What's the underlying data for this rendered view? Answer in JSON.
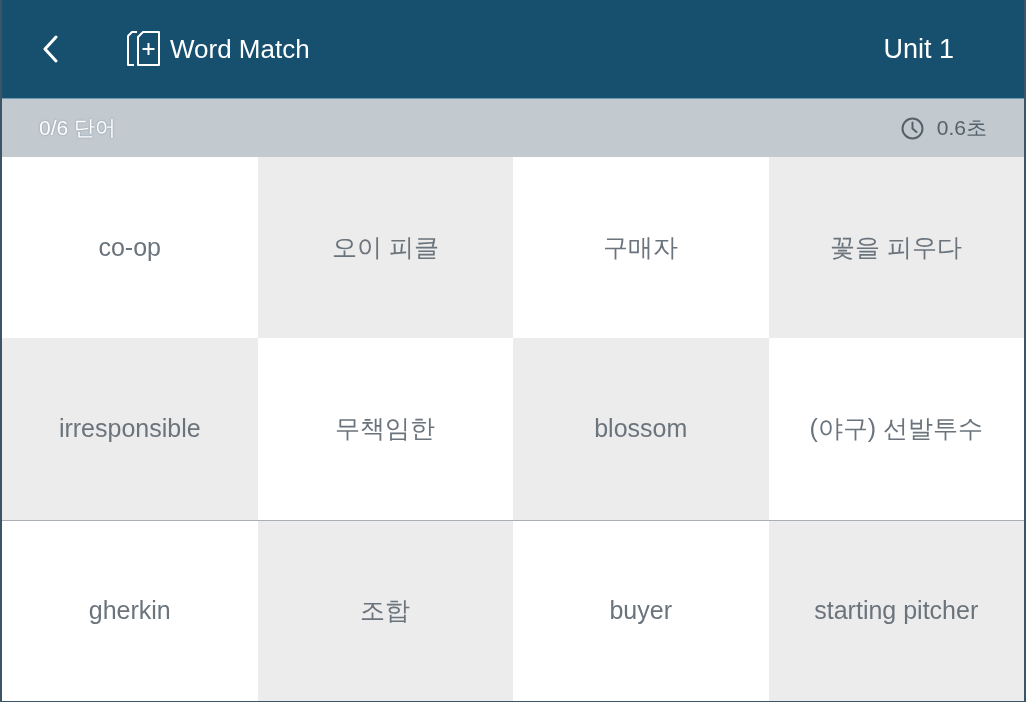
{
  "header": {
    "title": "Word Match",
    "unit": "Unit 1"
  },
  "status_bar": {
    "count": "0/6 단어",
    "time": "0.6초"
  },
  "board": {
    "rows": [
      [
        {
          "text": "co-op"
        },
        {
          "text": "오이 피클"
        },
        {
          "text": "구매자"
        },
        {
          "text": "꽃을 피우다"
        }
      ],
      [
        {
          "text": "irresponsible"
        },
        {
          "text": "무책임한"
        },
        {
          "text": "blossom"
        },
        {
          "text": "(야구) 선발투수"
        }
      ],
      [
        {
          "text": "gherkin"
        },
        {
          "text": "조합"
        },
        {
          "text": "buyer"
        },
        {
          "text": "starting pitcher"
        }
      ]
    ]
  }
}
